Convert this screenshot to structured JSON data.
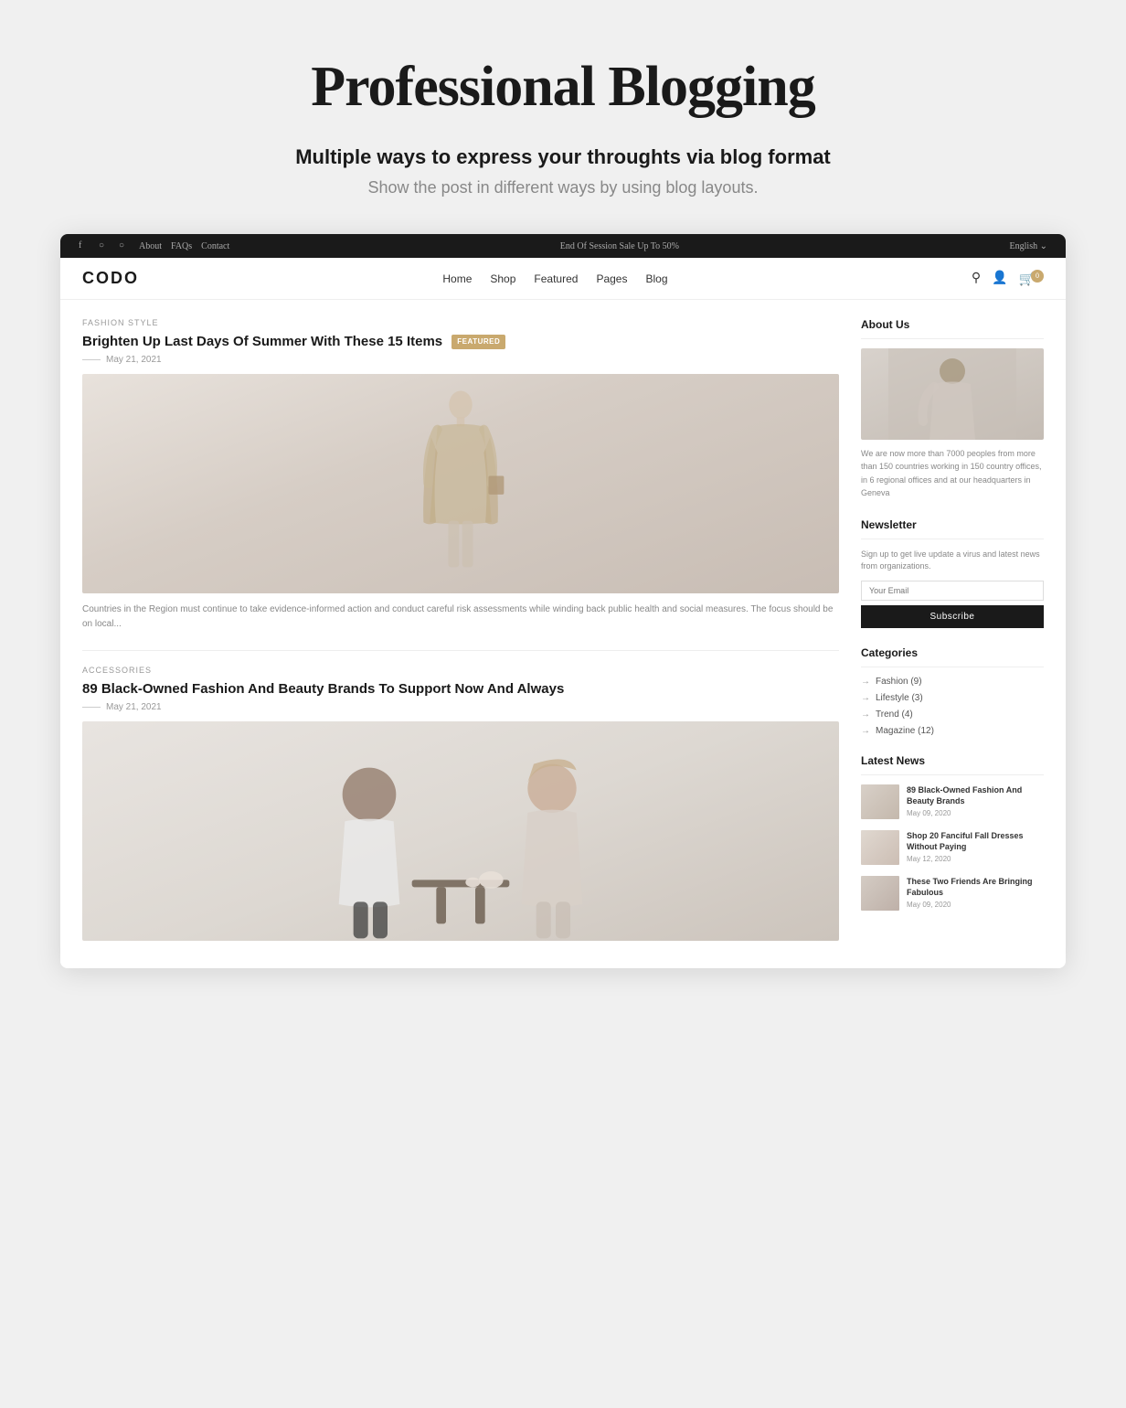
{
  "hero": {
    "title": "Professional Blogging",
    "subtitle": "Multiple ways to express your throughts via blog format",
    "description": "Show the post in different ways by using blog layouts."
  },
  "topbar": {
    "sale_text": "End Of Session Sale Up To 50%",
    "language": "English",
    "nav_links": [
      "About",
      "FAQs",
      "Contact"
    ],
    "social_icons": [
      "f",
      "IG",
      "P"
    ]
  },
  "navbar": {
    "logo": "CODO",
    "links": [
      "Home",
      "Shop",
      "Featured",
      "Pages",
      "Blog"
    ],
    "cart_count": "0"
  },
  "posts": [
    {
      "category": "FASHION  STYLE",
      "title": "Brighten Up Last Days Of Summer With These  15 Items",
      "badge": "FEATURED",
      "date": "May 21, 2021",
      "excerpt": "Countries in the Region must continue to take evidence-informed action and conduct careful risk assessments while winding back public health and social measures. The focus should be on local..."
    },
    {
      "category": "ACCESSORIES",
      "title": "89 Black-Owned Fashion And Beauty Brands To Support Now And Always",
      "badge": "",
      "date": "May 21, 2021",
      "excerpt": ""
    }
  ],
  "sidebar": {
    "about": {
      "title": "About Us",
      "text": "We are now more than 7000 peoples from more than 150 countries working in 150 country offices, in 6 regional offices and at our headquarters in Geneva"
    },
    "newsletter": {
      "title": "Newsletter",
      "text": "Sign up to get live update a virus and latest news from organizations.",
      "placeholder": "Your Email",
      "button": "Subscribe"
    },
    "categories": {
      "title": "Categories",
      "items": [
        "Fashion (9)",
        "Lifestyle (3)",
        "Trend (4)",
        "Magazine (12)"
      ]
    },
    "latest_news": {
      "title": "Latest News",
      "items": [
        {
          "title": "89 Black-Owned Fashion And Beauty Brands",
          "date": "May 09, 2020"
        },
        {
          "title": "Shop 20 Fanciful Fall Dresses Without Paying",
          "date": "May 12, 2020"
        },
        {
          "title": "These Two Friends Are Bringing Fabulous",
          "date": "May 09, 2020"
        }
      ]
    }
  }
}
